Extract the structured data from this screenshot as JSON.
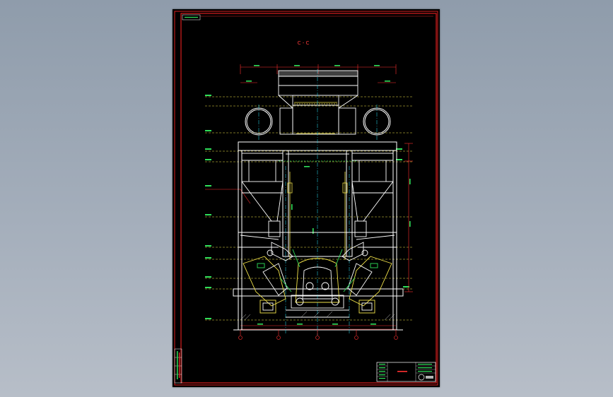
{
  "drawing": {
    "section_label": "C - C",
    "title_stamp": "",
    "palette": {
      "background": "#000000",
      "frame": "#d81f1f",
      "structure": "#ffffff",
      "dimension": "#ff3030",
      "level_line": "#f2e34a",
      "center_line": "#22c3d6",
      "detail": "#2fe05a",
      "hatch": "#c8c8c8"
    },
    "level_marks": 12,
    "grid_axes": 5
  },
  "title_block": {
    "rows": 6
  }
}
